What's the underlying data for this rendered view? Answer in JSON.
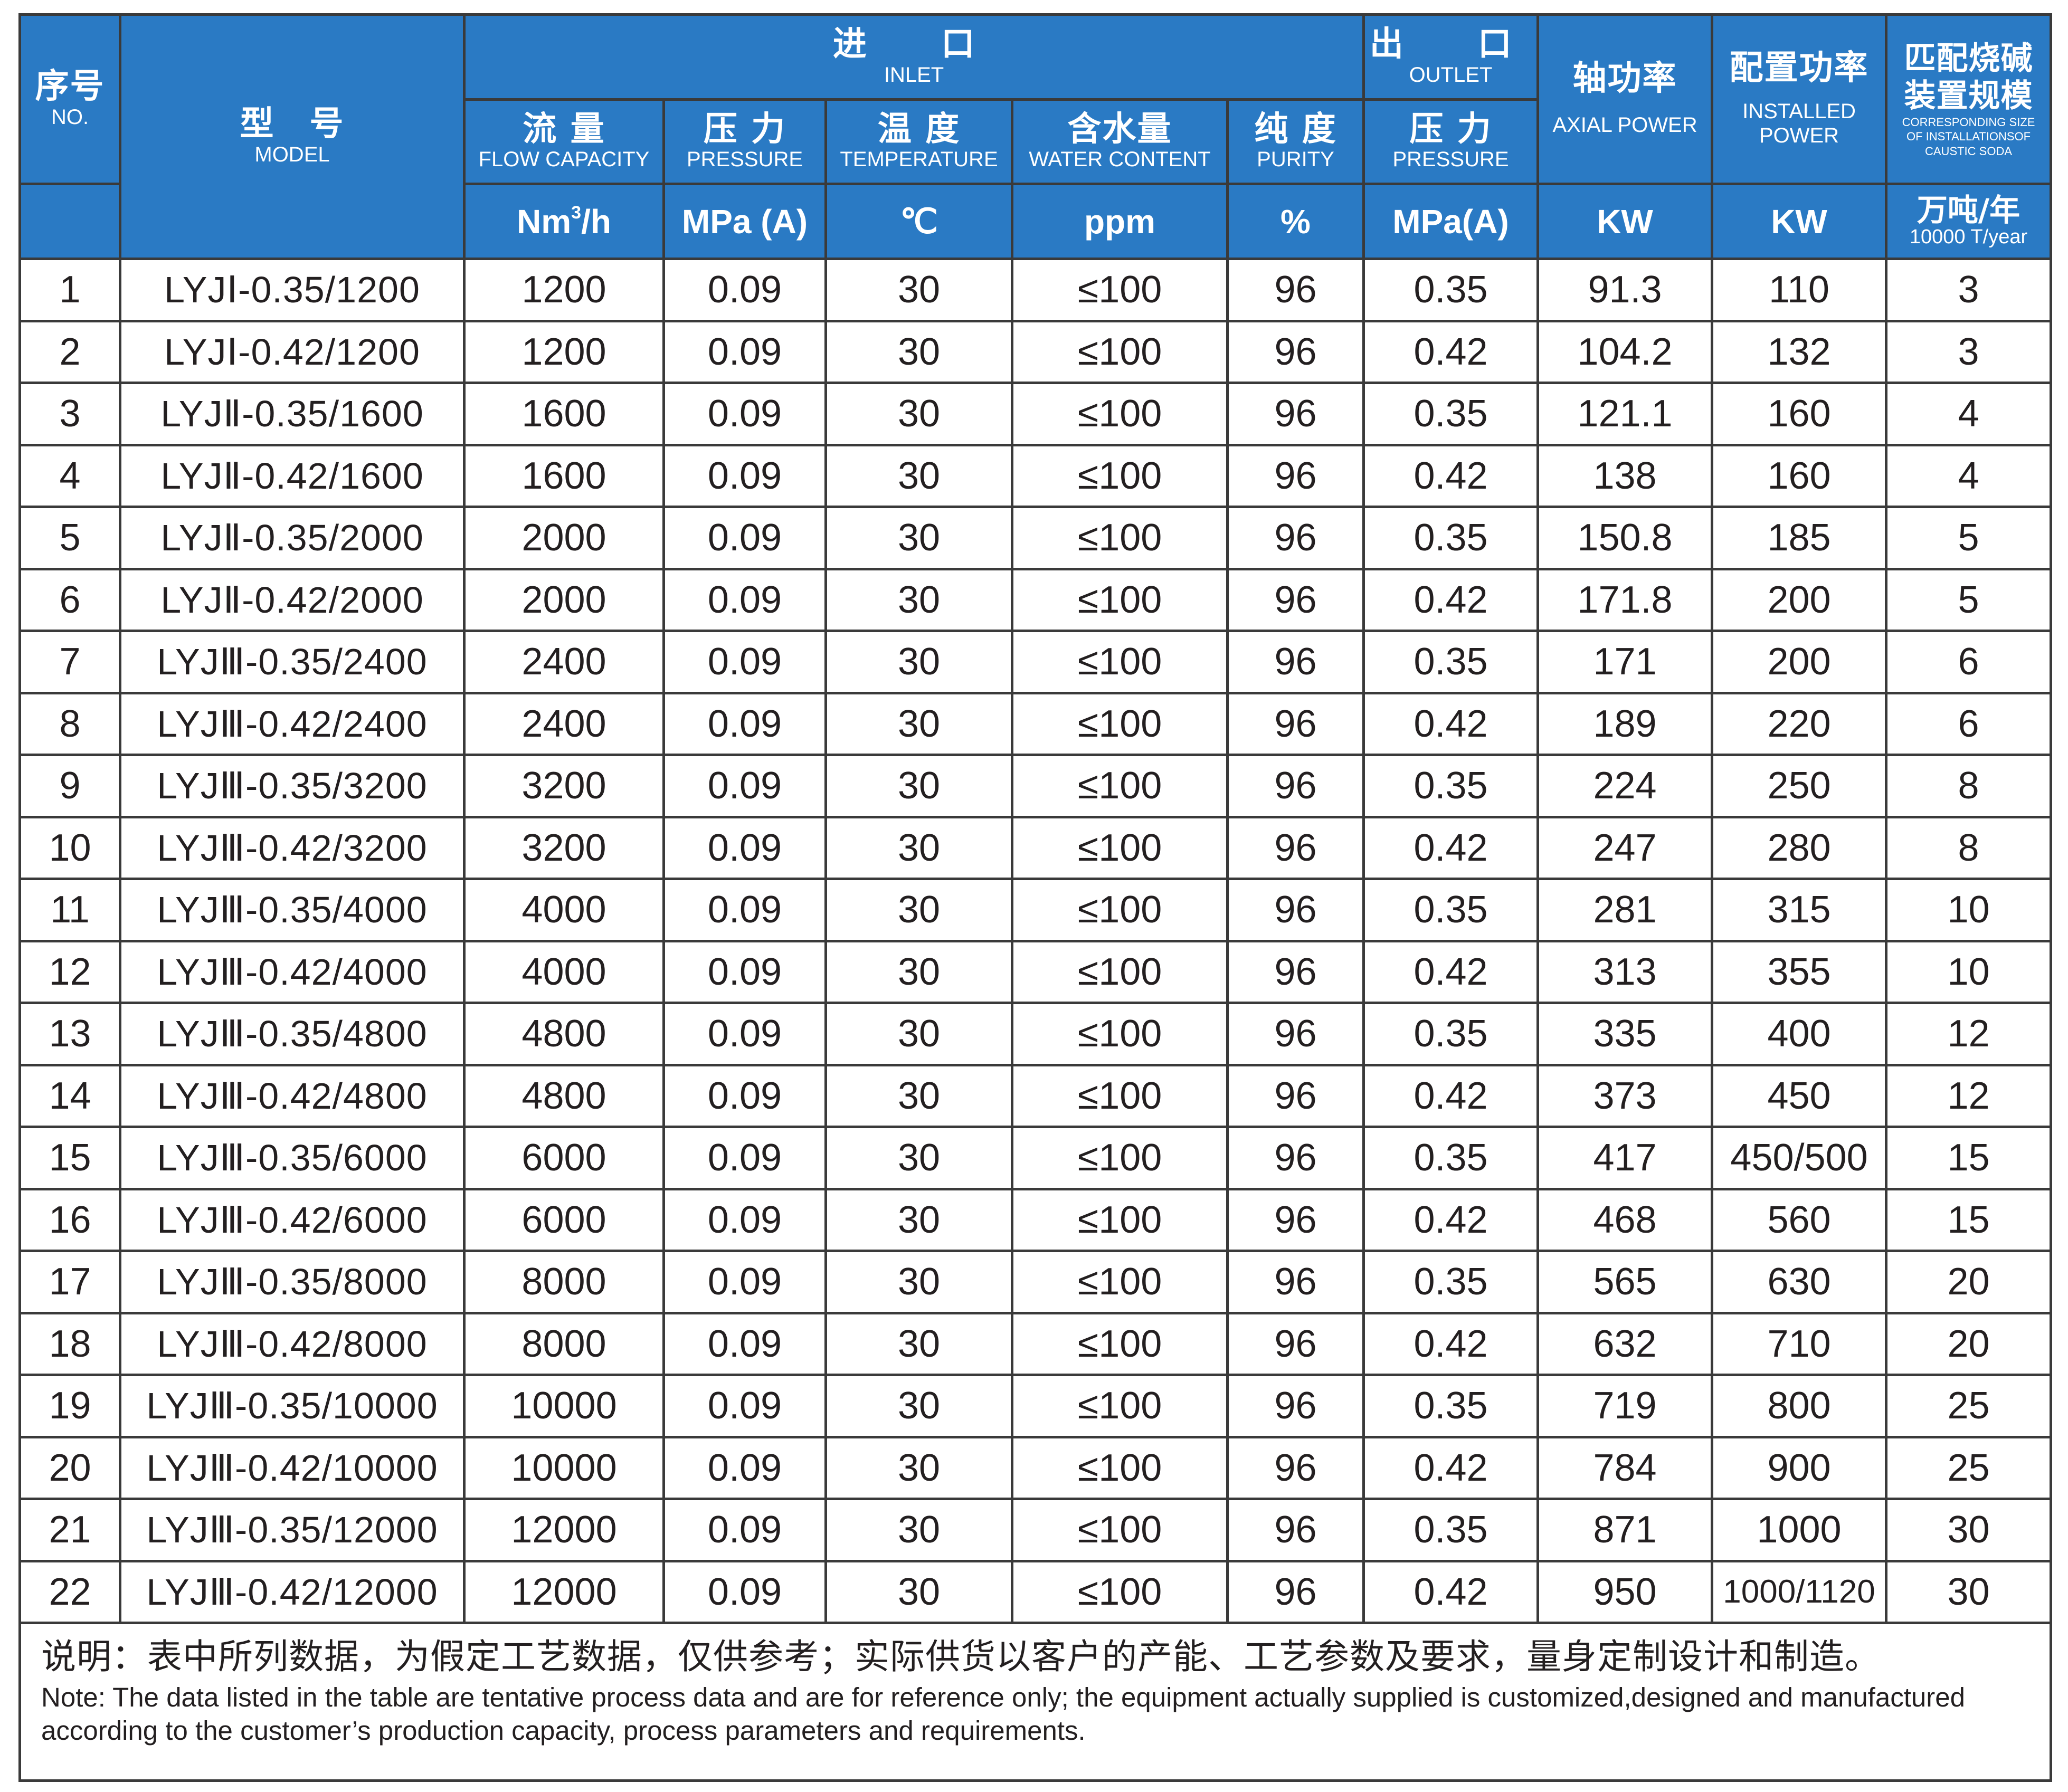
{
  "header": {
    "no": {
      "cn": "序号",
      "en": "NO."
    },
    "model": {
      "cn": "型　号",
      "en": "MODEL"
    },
    "inlet": {
      "cn": "进　口",
      "en": "INLET"
    },
    "outlet": {
      "cn": "出　口",
      "en": "OUTLET"
    },
    "axial_power": {
      "cn": "轴功率",
      "en": "AXIAL POWER",
      "unit": "KW"
    },
    "installed_power": {
      "cn": "配置功率",
      "en_line1": "INSTALLED",
      "en_line2": "POWER",
      "unit": "KW"
    },
    "caustic": {
      "cn_line1": "匹配烧碱",
      "cn_line2": "装置规模",
      "en_line1": "CORRESPONDING SIZE",
      "en_line2": "OF INSTALLATIONSOF",
      "en_line3": "CAUSTIC SODA",
      "unit_cn": "万吨/年",
      "unit_en": "10000 T/year"
    },
    "flow": {
      "cn": "流 量",
      "en": "FLOW CAPACITY",
      "unit_base": "Nm",
      "unit_sup": "3",
      "unit_tail": "/h"
    },
    "pressure_in": {
      "cn": "压 力",
      "en": "PRESSURE",
      "unit": "MPa (A)"
    },
    "temperature": {
      "cn": "温 度",
      "en": "TEMPERATURE",
      "unit": "℃"
    },
    "water": {
      "cn": "含水量",
      "en": "WATER CONTENT",
      "unit": "ppm"
    },
    "purity": {
      "cn": "纯 度",
      "en": "PURITY",
      "unit": "%"
    },
    "pressure_out": {
      "cn": "压 力",
      "en": "PRESSURE",
      "unit": "MPa(A)"
    }
  },
  "rows": [
    [
      "1",
      "LYJⅠ-0.35/1200",
      "1200",
      "0.09",
      "30",
      "≤100",
      "96",
      "0.35",
      "91.3",
      "110",
      "3"
    ],
    [
      "2",
      "LYJⅠ-0.42/1200",
      "1200",
      "0.09",
      "30",
      "≤100",
      "96",
      "0.42",
      "104.2",
      "132",
      "3"
    ],
    [
      "3",
      "LYJⅡ-0.35/1600",
      "1600",
      "0.09",
      "30",
      "≤100",
      "96",
      "0.35",
      "121.1",
      "160",
      "4"
    ],
    [
      "4",
      "LYJⅡ-0.42/1600",
      "1600",
      "0.09",
      "30",
      "≤100",
      "96",
      "0.42",
      "138",
      "160",
      "4"
    ],
    [
      "5",
      "LYJⅡ-0.35/2000",
      "2000",
      "0.09",
      "30",
      "≤100",
      "96",
      "0.35",
      "150.8",
      "185",
      "5"
    ],
    [
      "6",
      "LYJⅡ-0.42/2000",
      "2000",
      "0.09",
      "30",
      "≤100",
      "96",
      "0.42",
      "171.8",
      "200",
      "5"
    ],
    [
      "7",
      "LYJⅢ-0.35/2400",
      "2400",
      "0.09",
      "30",
      "≤100",
      "96",
      "0.35",
      "171",
      "200",
      "6"
    ],
    [
      "8",
      "LYJⅢ-0.42/2400",
      "2400",
      "0.09",
      "30",
      "≤100",
      "96",
      "0.42",
      "189",
      "220",
      "6"
    ],
    [
      "9",
      "LYJⅢ-0.35/3200",
      "3200",
      "0.09",
      "30",
      "≤100",
      "96",
      "0.35",
      "224",
      "250",
      "8"
    ],
    [
      "10",
      "LYJⅢ-0.42/3200",
      "3200",
      "0.09",
      "30",
      "≤100",
      "96",
      "0.42",
      "247",
      "280",
      "8"
    ],
    [
      "11",
      "LYJⅢ-0.35/4000",
      "4000",
      "0.09",
      "30",
      "≤100",
      "96",
      "0.35",
      "281",
      "315",
      "10"
    ],
    [
      "12",
      "LYJⅢ-0.42/4000",
      "4000",
      "0.09",
      "30",
      "≤100",
      "96",
      "0.42",
      "313",
      "355",
      "10"
    ],
    [
      "13",
      "LYJⅢ-0.35/4800",
      "4800",
      "0.09",
      "30",
      "≤100",
      "96",
      "0.35",
      "335",
      "400",
      "12"
    ],
    [
      "14",
      "LYJⅢ-0.42/4800",
      "4800",
      "0.09",
      "30",
      "≤100",
      "96",
      "0.42",
      "373",
      "450",
      "12"
    ],
    [
      "15",
      "LYJⅢ-0.35/6000",
      "6000",
      "0.09",
      "30",
      "≤100",
      "96",
      "0.35",
      "417",
      "450/500",
      "15"
    ],
    [
      "16",
      "LYJⅢ-0.42/6000",
      "6000",
      "0.09",
      "30",
      "≤100",
      "96",
      "0.42",
      "468",
      "560",
      "15"
    ],
    [
      "17",
      "LYJⅢ-0.35/8000",
      "8000",
      "0.09",
      "30",
      "≤100",
      "96",
      "0.35",
      "565",
      "630",
      "20"
    ],
    [
      "18",
      "LYJⅢ-0.42/8000",
      "8000",
      "0.09",
      "30",
      "≤100",
      "96",
      "0.42",
      "632",
      "710",
      "20"
    ],
    [
      "19",
      "LYJⅢ-0.35/10000",
      "10000",
      "0.09",
      "30",
      "≤100",
      "96",
      "0.35",
      "719",
      "800",
      "25"
    ],
    [
      "20",
      "LYJⅢ-0.42/10000",
      "10000",
      "0.09",
      "30",
      "≤100",
      "96",
      "0.42",
      "784",
      "900",
      "25"
    ],
    [
      "21",
      "LYJⅢ-0.35/12000",
      "12000",
      "0.09",
      "30",
      "≤100",
      "96",
      "0.35",
      "871",
      "1000",
      "30"
    ],
    [
      "22",
      "LYJⅢ-0.42/12000",
      "12000",
      "0.09",
      "30",
      "≤100",
      "96",
      "0.42",
      "950",
      "1000/1120",
      "30"
    ]
  ],
  "note": {
    "cn": "说明：表中所列数据，为假定工艺数据，仅供参考；实际供货以客户的产能、工艺参数及要求，量身定制设计和制造。",
    "en": "Note: The data listed in the table are tentative process data and are for reference only; the equipment actually supplied is customized,designed and manufactured according to the customer’s production capacity, process parameters and requirements."
  },
  "colors": {
    "header_bg": "#2a7ac4",
    "header_text": "#ffffff",
    "border": "#3a3a3a"
  }
}
